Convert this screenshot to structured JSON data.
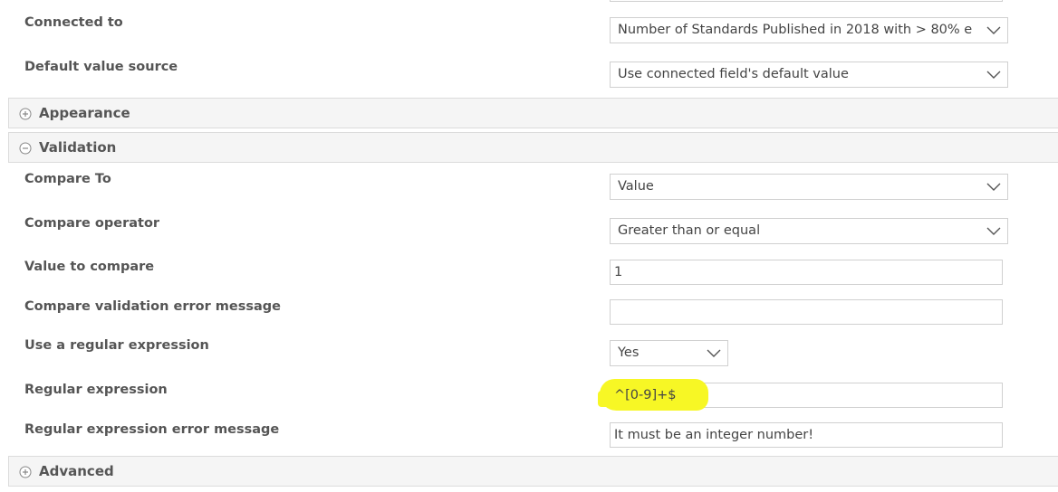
{
  "fields": {
    "connected_to": {
      "label": "Connected to",
      "value": "Number of Standards Published in 2018 with > 80% e"
    },
    "default_value_source": {
      "label": "Default value source",
      "value": "Use connected field's default value"
    },
    "compare_to": {
      "label": "Compare To",
      "value": "Value"
    },
    "compare_operator": {
      "label": "Compare operator",
      "value": "Greater than or equal"
    },
    "value_to_compare": {
      "label": "Value to compare",
      "value": "1"
    },
    "compare_error": {
      "label": "Compare validation error message",
      "value": ""
    },
    "use_regex": {
      "label": "Use a regular expression",
      "value": "Yes"
    },
    "regex": {
      "label": "Regular expression",
      "value": "^[0-9]+$"
    },
    "regex_error": {
      "label": "Regular expression error message",
      "value": "It must be an integer number!"
    }
  },
  "sections": {
    "appearance": {
      "title": "Appearance",
      "icon": "plus-circle-icon",
      "expanded": false
    },
    "validation": {
      "title": "Validation",
      "icon": "minus-circle-icon",
      "expanded": true
    },
    "advanced": {
      "title": "Advanced",
      "icon": "plus-circle-icon",
      "expanded": false
    }
  },
  "colors": {
    "highlight": "#f7f725",
    "section_bg": "#f5f5f5",
    "label": "#555555"
  }
}
